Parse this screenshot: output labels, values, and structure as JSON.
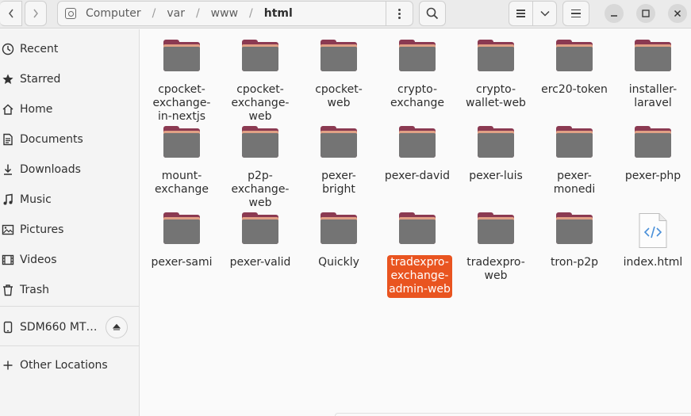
{
  "header": {
    "path": [
      "Computer",
      "var",
      "www",
      "html"
    ],
    "back_icon": "chevron-left-icon",
    "forward_icon": "chevron-right-icon",
    "location_icon": "drive-icon",
    "path_menu_icon": "vertical-ellipsis-icon",
    "search_icon": "search-icon",
    "view_icon": "list-view-icon",
    "view_dropdown_icon": "chevron-down-icon",
    "menu_icon": "hamburger-icon",
    "minimize_icon": "minimize-icon",
    "maximize_icon": "maximize-icon",
    "close_icon": "close-icon"
  },
  "sidebar": {
    "items": [
      {
        "label": "Recent",
        "icon": "clock-icon"
      },
      {
        "label": "Starred",
        "icon": "star-icon"
      },
      {
        "label": "Home",
        "icon": "home-icon"
      },
      {
        "label": "Documents",
        "icon": "document-icon"
      },
      {
        "label": "Downloads",
        "icon": "download-icon"
      },
      {
        "label": "Music",
        "icon": "music-icon"
      },
      {
        "label": "Pictures",
        "icon": "picture-icon"
      },
      {
        "label": "Videos",
        "icon": "video-icon"
      },
      {
        "label": "Trash",
        "icon": "trash-icon"
      }
    ],
    "device": {
      "label": "SDM660 MT…",
      "icon": "phone-icon",
      "eject_icon": "eject-icon"
    },
    "other": {
      "label": "Other Locations",
      "icon": "plus-icon"
    }
  },
  "files": [
    {
      "name": "cpocket-exchange-in-nextjs",
      "lines": [
        "cpocket-",
        "exchange-",
        "in-nextjs"
      ],
      "type": "folder"
    },
    {
      "name": "cpocket-exchange-web",
      "lines": [
        "cpocket-",
        "exchange-",
        "web"
      ],
      "type": "folder"
    },
    {
      "name": "cpocket-web",
      "lines": [
        "cpocket-",
        "web"
      ],
      "type": "folder"
    },
    {
      "name": "crypto-exchange",
      "lines": [
        "crypto-",
        "exchange"
      ],
      "type": "folder"
    },
    {
      "name": "crypto-wallet-web",
      "lines": [
        "crypto-",
        "wallet-web"
      ],
      "type": "folder"
    },
    {
      "name": "erc20-token",
      "lines": [
        "erc20-token"
      ],
      "type": "folder"
    },
    {
      "name": "installer-laravel",
      "lines": [
        "installer-",
        "laravel"
      ],
      "type": "folder"
    },
    {
      "name": "mount-exchange",
      "lines": [
        "mount-",
        "exchange"
      ],
      "type": "folder"
    },
    {
      "name": "p2p-exchange-web",
      "lines": [
        "p2p-",
        "exchange-",
        "web"
      ],
      "type": "folder"
    },
    {
      "name": "pexer-bright",
      "lines": [
        "pexer-",
        "bright"
      ],
      "type": "folder"
    },
    {
      "name": "pexer-david",
      "lines": [
        "pexer-david"
      ],
      "type": "folder"
    },
    {
      "name": "pexer-luis",
      "lines": [
        "pexer-luis"
      ],
      "type": "folder"
    },
    {
      "name": "pexer-monedi",
      "lines": [
        "pexer-",
        "monedi"
      ],
      "type": "folder"
    },
    {
      "name": "pexer-php",
      "lines": [
        "pexer-php"
      ],
      "type": "folder"
    },
    {
      "name": "pexer-sami",
      "lines": [
        "pexer-sami"
      ],
      "type": "folder"
    },
    {
      "name": "pexer-valid",
      "lines": [
        "pexer-valid"
      ],
      "type": "folder"
    },
    {
      "name": "Quickly",
      "lines": [
        "Quickly"
      ],
      "type": "folder"
    },
    {
      "name": "tradexpro-exchange-admin-web",
      "lines": [
        "tradexpro-",
        "exchange-",
        "admin-web"
      ],
      "type": "folder",
      "selected": true
    },
    {
      "name": "tradexpro-web",
      "lines": [
        "tradexpro-",
        "web"
      ],
      "type": "folder"
    },
    {
      "name": "tron-p2p",
      "lines": [
        "tron-p2p"
      ],
      "type": "folder"
    },
    {
      "name": "index.html",
      "lines": [
        "index.html"
      ],
      "type": "html-file"
    }
  ],
  "colors": {
    "accent": "#e95420",
    "folder_front": "#747474",
    "folder_back": "#8b3a52",
    "folder_band": "#e0a085"
  }
}
